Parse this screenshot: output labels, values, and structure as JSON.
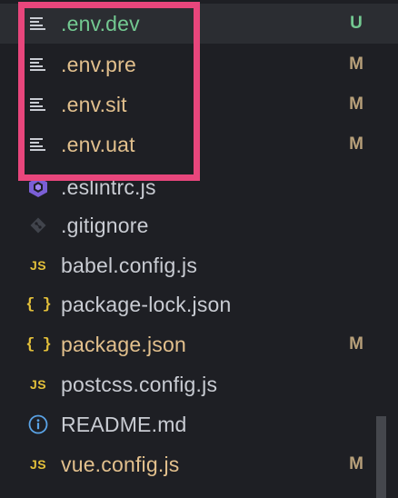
{
  "colors": {
    "background": "#1e1f24",
    "text_default": "#c9ccd3",
    "text_modified": "#e2c08d",
    "text_untracked": "#73c991",
    "badge_modified": "#b8a07a",
    "badge_untracked": "#73c991",
    "highlight": "#e8467c"
  },
  "files": [
    {
      "name": ".env.dev",
      "icon": "lines-icon",
      "badge": "U",
      "status": "untracked"
    },
    {
      "name": ".env.pre",
      "icon": "lines-icon",
      "badge": "M",
      "status": "modified"
    },
    {
      "name": ".env.sit",
      "icon": "lines-icon",
      "badge": "M",
      "status": "modified"
    },
    {
      "name": ".env.uat",
      "icon": "lines-icon",
      "badge": "M",
      "status": "modified"
    },
    {
      "name": ".eslintrc.js",
      "icon": "eslint-icon",
      "badge": "",
      "status": "none"
    },
    {
      "name": ".gitignore",
      "icon": "git-icon",
      "badge": "",
      "status": "none"
    },
    {
      "name": "babel.config.js",
      "icon": "js-icon",
      "badge": "",
      "status": "none"
    },
    {
      "name": "package-lock.json",
      "icon": "json-icon",
      "badge": "",
      "status": "none"
    },
    {
      "name": "package.json",
      "icon": "json-icon",
      "badge": "M",
      "status": "modified"
    },
    {
      "name": "postcss.config.js",
      "icon": "js-icon",
      "badge": "",
      "status": "none"
    },
    {
      "name": "README.md",
      "icon": "info-icon",
      "badge": "",
      "status": "none"
    },
    {
      "name": "vue.config.js",
      "icon": "js-icon",
      "badge": "M",
      "status": "modified"
    }
  ],
  "icon_glyphs": {
    "js": "JS",
    "json": "{ }"
  }
}
